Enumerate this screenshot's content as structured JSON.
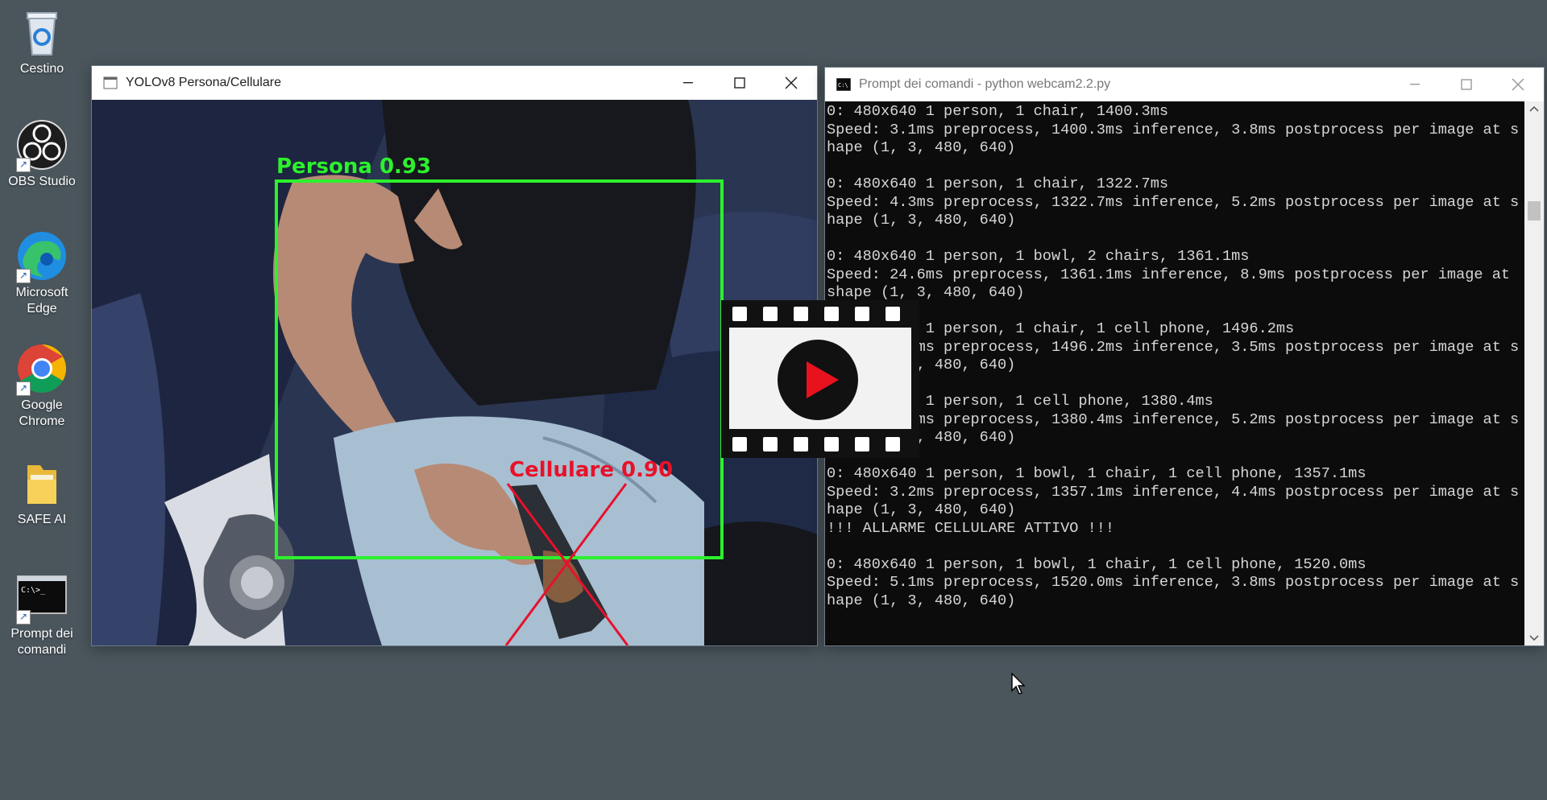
{
  "desktop": {
    "icons": [
      {
        "label": "Cestino",
        "icon": "recycle-bin-icon"
      },
      {
        "label": "OBS Studio",
        "icon": "obs-icon"
      },
      {
        "label": "Microsoft Edge",
        "icon": "edge-icon"
      },
      {
        "label": "Google Chrome",
        "icon": "chrome-icon"
      },
      {
        "label": "SAFE AI",
        "icon": "folder-icon"
      },
      {
        "label": "Prompt dei comandi",
        "icon": "cmd-icon"
      }
    ]
  },
  "yolo_window": {
    "title": "YOLOv8 Persona/Cellulare",
    "detections": [
      {
        "label": "Persona 0.93",
        "color": "#2cf12c"
      },
      {
        "label": "Cellulare 0.90",
        "color": "#e8112a"
      }
    ]
  },
  "cmd_window": {
    "title": "Prompt dei comandi - python  webcam2.2.py",
    "lines": [
      "0: 480x640 1 person, 1 chair, 1400.3ms",
      "Speed: 3.1ms preprocess, 1400.3ms inference, 3.8ms postprocess per image at s",
      "hape (1, 3, 480, 640)",
      "",
      "0: 480x640 1 person, 1 chair, 1322.7ms",
      "Speed: 4.3ms preprocess, 1322.7ms inference, 5.2ms postprocess per image at s",
      "hape (1, 3, 480, 640)",
      "",
      "0: 480x640 1 person, 1 bowl, 2 chairs, 1361.1ms",
      "Speed: 24.6ms preprocess, 1361.1ms inference, 8.9ms postprocess per image at",
      "shape (1, 3, 480, 640)",
      "",
      "0: 480x640 1 person, 1 chair, 1 cell phone, 1496.2ms",
      "Speed: 3.6ms preprocess, 1496.2ms inference, 3.5ms postprocess per image at s",
      "hape (1, 3, 480, 640)",
      "",
      "0: 480x640 1 person, 1 cell phone, 1380.4ms",
      "Speed: 3.4ms preprocess, 1380.4ms inference, 5.2ms postprocess per image at s",
      "hape (1, 3, 480, 640)",
      "",
      "0: 480x640 1 person, 1 bowl, 1 chair, 1 cell phone, 1357.1ms",
      "Speed: 3.2ms preprocess, 1357.1ms inference, 4.4ms postprocess per image at s",
      "hape (1, 3, 480, 640)",
      "!!! ALLARME CELLULARE ATTIVO !!!",
      "",
      "0: 480x640 1 person, 1 bowl, 1 chair, 1 cell phone, 1520.0ms",
      "Speed: 5.1ms preprocess, 1520.0ms inference, 3.8ms postprocess per image at s",
      "hape (1, 3, 480, 640)"
    ]
  },
  "overlay": {
    "icon": "video-play-icon",
    "play_color": "#e8111e"
  }
}
